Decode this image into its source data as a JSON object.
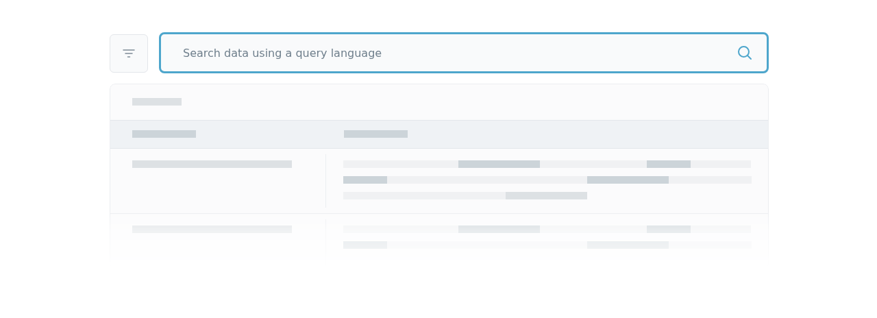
{
  "search": {
    "placeholder": "Search data using a query language"
  }
}
